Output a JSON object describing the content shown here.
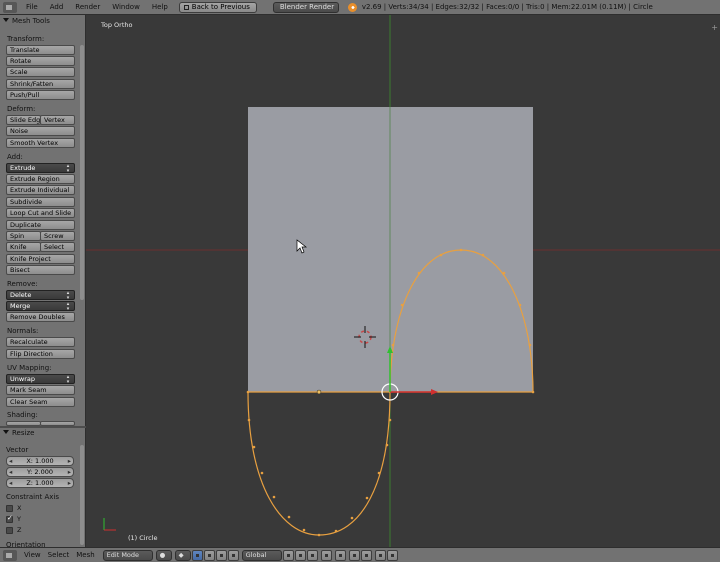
{
  "topbar": {
    "menus": [
      "File",
      "Add",
      "Render",
      "Window",
      "Help"
    ],
    "back_button": "Back to Previous",
    "render_engine": "Blender Render",
    "stats": "v2.69 | Verts:34/34 | Edges:32/32 | Faces:0/0 | Tris:0 | Mem:22.01M (0.11M) | Circle"
  },
  "shelf": {
    "panel_title": "Mesh Tools",
    "transform": {
      "label": "Transform:",
      "buttons": [
        "Translate",
        "Rotate",
        "Scale",
        "Shrink/Fatten",
        "Push/Pull"
      ]
    },
    "deform": {
      "label": "Deform:",
      "slide_edge": "Slide Edge",
      "vertex": "Vertex",
      "noise": "Noise",
      "smooth_vertex": "Smooth Vertex"
    },
    "add": {
      "label": "Add:",
      "extrude": "Extrude",
      "extrude_region": "Extrude Region",
      "extrude_individual": "Extrude Individual",
      "subdivide": "Subdivide",
      "loop_cut": "Loop Cut and Slide",
      "duplicate": "Duplicate",
      "spin": "Spin",
      "screw": "Screw",
      "knife": "Knife",
      "select": "Select",
      "knife_project": "Knife Project",
      "bisect": "Bisect"
    },
    "remove": {
      "label": "Remove:",
      "delete": "Delete",
      "merge": "Merge",
      "remove_doubles": "Remove Doubles"
    },
    "normals": {
      "label": "Normals:",
      "recalculate": "Recalculate",
      "flip": "Flip Direction"
    },
    "uv": {
      "label": "UV Mapping:",
      "unwrap": "Unwrap",
      "mark_seam": "Mark Seam",
      "clear_seam": "Clear Seam"
    },
    "shading": {
      "label": "Shading:"
    },
    "resize": {
      "panel_title": "Resize",
      "vector_label": "Vector",
      "x": "X: 1.000",
      "y": "Y: 2.000",
      "z": "Z: 1.000",
      "constraint_label": "Constraint Axis",
      "axes": [
        "X",
        "Y",
        "Z"
      ],
      "axis_checked": [
        false,
        true,
        false
      ],
      "orientation_label": "Orientation"
    }
  },
  "viewport": {
    "view_name": "Top Ortho",
    "object_label": "(1) Circle",
    "colors": {
      "background": "#393939",
      "plane": "#9a9ca3",
      "edge": "#e8a040",
      "x_axis": "#8a2a2a",
      "y_axis": "#3c8a2a"
    }
  },
  "bottombar": {
    "menus": [
      "View",
      "Select",
      "Mesh"
    ],
    "mode": "Edit Mode",
    "orientation": "Global"
  }
}
